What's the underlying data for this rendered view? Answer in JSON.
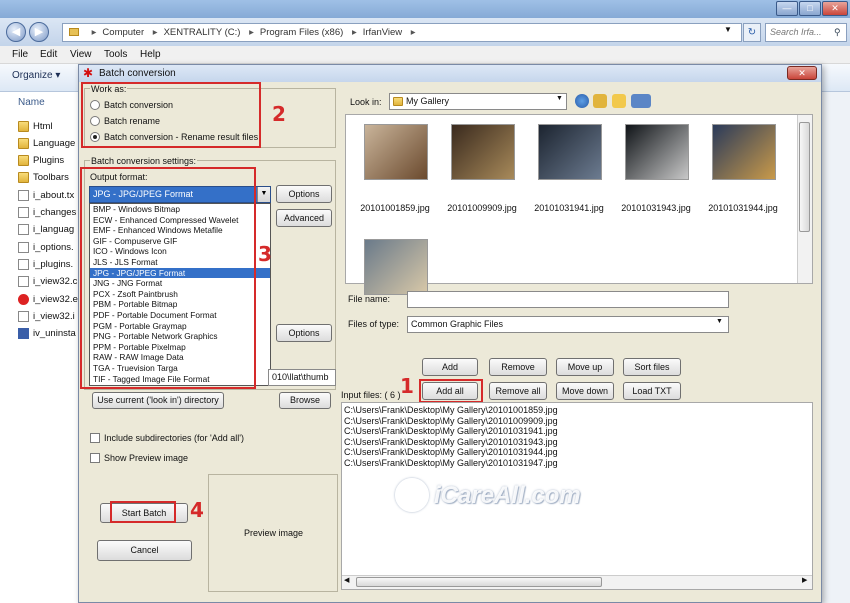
{
  "explorer": {
    "breadcrumb": [
      "Computer",
      "XENTRALITY (C:)",
      "Program Files (x86)",
      "IrfanView"
    ],
    "search_placeholder": "Search Irfa...",
    "menu": [
      "File",
      "Edit",
      "View",
      "Tools",
      "Help"
    ],
    "organize_label": "Organize ▾",
    "name_column": "Name",
    "files": [
      {
        "name": "Html",
        "icon": "folder-icon"
      },
      {
        "name": "Language",
        "icon": "folder-icon"
      },
      {
        "name": "Plugins",
        "icon": "folder-icon"
      },
      {
        "name": "Toolbars",
        "icon": "folder-icon"
      },
      {
        "name": "i_about.tx",
        "icon": "document-icon"
      },
      {
        "name": "i_changes",
        "icon": "document-icon"
      },
      {
        "name": "i_languag",
        "icon": "document-icon"
      },
      {
        "name": "i_options.",
        "icon": "document-icon"
      },
      {
        "name": "i_plugins.",
        "icon": "document-icon"
      },
      {
        "name": "i_view32.c",
        "icon": "help-file-icon"
      },
      {
        "name": "i_view32.e",
        "icon": "irfanview-icon"
      },
      {
        "name": "i_view32.i",
        "icon": "document-icon"
      },
      {
        "name": "iv_uninsta",
        "icon": "uninstall-icon"
      }
    ]
  },
  "dialog": {
    "title": "Batch conversion",
    "work_as": {
      "label": "Work as:",
      "options": [
        "Batch conversion",
        "Batch rename",
        "Batch conversion - Rename result files"
      ],
      "selected_index": 2
    },
    "settings_label": "Batch conversion settings:",
    "output_format_label": "Output format:",
    "selected_format": "JPG - JPG/JPEG Format",
    "formats": [
      "BMP - Windows Bitmap",
      "ECW - Enhanced Compressed Wavelet",
      "EMF - Enhanced Windows Metafile",
      "GIF - Compuserve GIF",
      "ICO - Windows Icon",
      "JLS - JLS Format",
      "JPG - JPG/JPEG Format",
      "JNG - JNG Format",
      "PCX - Zsoft Paintbrush",
      "PBM - Portable Bitmap",
      "PDF - Portable Document Format",
      "PGM - Portable Graymap",
      "PNG - Portable Network Graphics",
      "PPM - Portable Pixelmap",
      "RAW - RAW Image Data",
      "TGA - Truevision Targa",
      "TIF - Tagged Image File Format"
    ],
    "selected_format_index": 6,
    "options_btn": "Options",
    "advanced_btn": "Advanced",
    "options_btn2": "Options",
    "output_dir_value": "010\\llat\\thumb",
    "use_current_btn": "Use current ('look in') directory",
    "browse_btn": "Browse",
    "include_subdirs": "Include subdirectories (for 'Add all')",
    "show_preview": "Show Preview image",
    "start_btn": "Start Batch",
    "cancel_btn": "Cancel",
    "preview_label": "Preview image",
    "look_in_label": "Look in:",
    "look_in_value": "My Gallery",
    "thumbnails": [
      "20101001859.jpg",
      "20101009909.jpg",
      "20101031941.jpg",
      "20101031943.jpg",
      "20101031944.jpg",
      ""
    ],
    "file_name_label": "File name:",
    "file_name_value": "",
    "files_of_type_label": "Files of type:",
    "files_of_type_value": "Common Graphic Files",
    "buttons": {
      "add": "Add",
      "remove": "Remove",
      "move_up": "Move up",
      "sort_files": "Sort files",
      "add_all": "Add all",
      "remove_all": "Remove all",
      "move_down": "Move down",
      "load_txt": "Load TXT"
    },
    "input_files_label": "Input files: ( 6 )",
    "input_files": [
      "C:\\Users\\Frank\\Desktop\\My Gallery\\20101001859.jpg",
      "C:\\Users\\Frank\\Desktop\\My Gallery\\20101009909.jpg",
      "C:\\Users\\Frank\\Desktop\\My Gallery\\20101031941.jpg",
      "C:\\Users\\Frank\\Desktop\\My Gallery\\20101031943.jpg",
      "C:\\Users\\Frank\\Desktop\\My Gallery\\20101031944.jpg",
      "C:\\Users\\Frank\\Desktop\\My Gallery\\20101031947.jpg"
    ]
  },
  "annotations": {
    "step1": "1",
    "step2": "2",
    "step3": "3",
    "step4": "4",
    "color": "#d52a2a"
  },
  "watermark": "iCareAll.com"
}
